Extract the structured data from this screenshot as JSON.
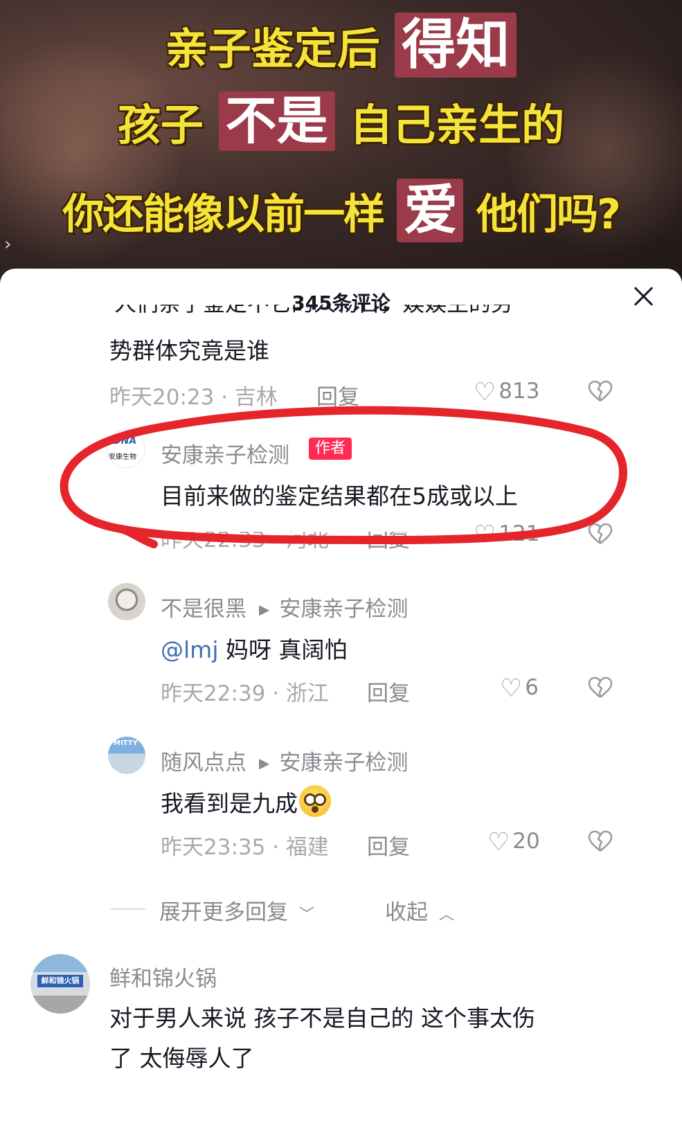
{
  "video": {
    "caption_line1": {
      "prefix": "亲子鉴定后",
      "highlight": "得知"
    },
    "caption_line2": {
      "prefix": "孩子",
      "highlight": "不是",
      "suffix": "自己亲生的"
    },
    "caption_line3": {
      "prefix": "你还能像以前一样",
      "highlight": "爱",
      "suffix": "他们吗?"
    }
  },
  "sheet": {
    "title": "345条评论",
    "close_icon": "close-icon"
  },
  "comments": [
    {
      "partial_text": "人们亲子鉴定不它的人物占，娱娱主的劳",
      "text": "势群体究竟是谁",
      "time": "昨天20:23",
      "location": "吉林",
      "reply_label": "回复",
      "likes": "813"
    },
    {
      "author": "安康亲子检测",
      "badge": "作者",
      "avatar_text_1": "DNA",
      "avatar_text_2": "安康生物",
      "text": "目前来做的鉴定结果都在5成或以上",
      "time": "昨天22:33",
      "location": "河北",
      "reply_label": "回复",
      "likes": "121"
    },
    {
      "author": "不是很黑",
      "reply_to": "安康亲子检测",
      "mention": "@lmj",
      "text": " 妈呀 真阔怕",
      "time": "昨天22:39",
      "location": "浙江",
      "reply_label": "回复",
      "likes": "6"
    },
    {
      "author": "随风点点",
      "reply_to": "安康亲子检测",
      "avatar_text": "MITTY",
      "text": "我看到是九成",
      "time": "昨天23:35",
      "location": "福建",
      "reply_label": "回复",
      "likes": "20"
    },
    {
      "author": "鲜和锦火锅",
      "avatar_text": "鲜和锦火锅",
      "text_line1": "对于男人来说 孩子不是自己的 这个事太伤",
      "text_line2": "了 太侮辱人了"
    }
  ],
  "replies_controls": {
    "expand_label": "展开更多回复",
    "collapse_label": "收起"
  },
  "separator": " · ",
  "colors": {
    "accent_badge": "#fe2c55",
    "highlight_circle": "#e5242b",
    "mention": "#3f6fb4",
    "caption_yellow": "#f6e33a",
    "caption_box": "#9b3a48"
  }
}
